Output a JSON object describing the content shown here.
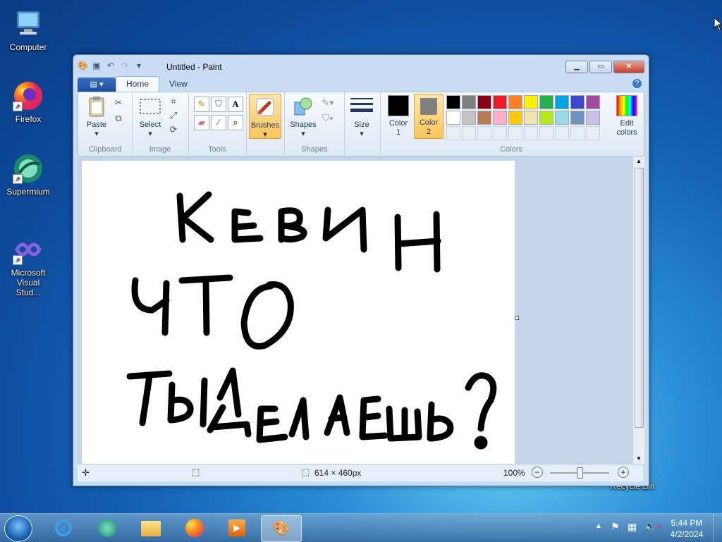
{
  "desktop": {
    "icons": [
      {
        "label": "Computer"
      },
      {
        "label": "Firefox"
      },
      {
        "label": "Supermium"
      },
      {
        "label": "Microsoft Visual Stud..."
      },
      {
        "label": "Recycle Bin"
      }
    ]
  },
  "window": {
    "title": "Untitled - Paint",
    "tabs": [
      "Home",
      "View"
    ],
    "ribbon": {
      "clipboard": {
        "paste": "Paste",
        "label": "Clipboard"
      },
      "image": {
        "select": "Select",
        "label": "Image"
      },
      "tools": {
        "label": "Tools"
      },
      "brushes": {
        "label": "Brushes"
      },
      "shapes": {
        "button": "Shapes",
        "label": "Shapes"
      },
      "size": {
        "label": "Size"
      },
      "colors": {
        "color1_line1": "Color",
        "color1_line2": "1",
        "color2_line1": "Color",
        "color2_line2": "2",
        "edit_line1": "Edit",
        "edit_line2": "colors",
        "label": "Colors",
        "color1": "#000000",
        "color2": "#7f7f7f",
        "row1": [
          "#000000",
          "#7f7f7f",
          "#880015",
          "#ed1c24",
          "#ff7f27",
          "#fff200",
          "#22b14c",
          "#00a2e8",
          "#3f48cc",
          "#a349a4"
        ],
        "row2": [
          "#ffffff",
          "#c3c3c3",
          "#b97a57",
          "#ffaec9",
          "#ffc90e",
          "#efe4b0",
          "#b5e61d",
          "#99d9ea",
          "#7092be",
          "#c8bfe7"
        ]
      }
    },
    "canvas": {
      "handwriting": [
        "КЕВИН",
        "ЧТО",
        "ТЫДЕЛАЕШЬ?"
      ]
    },
    "status": {
      "dimensions": "614 × 460px",
      "zoom": "100%"
    }
  },
  "taskbar": {
    "time": "5:44 PM",
    "date": "4/2/2024"
  }
}
